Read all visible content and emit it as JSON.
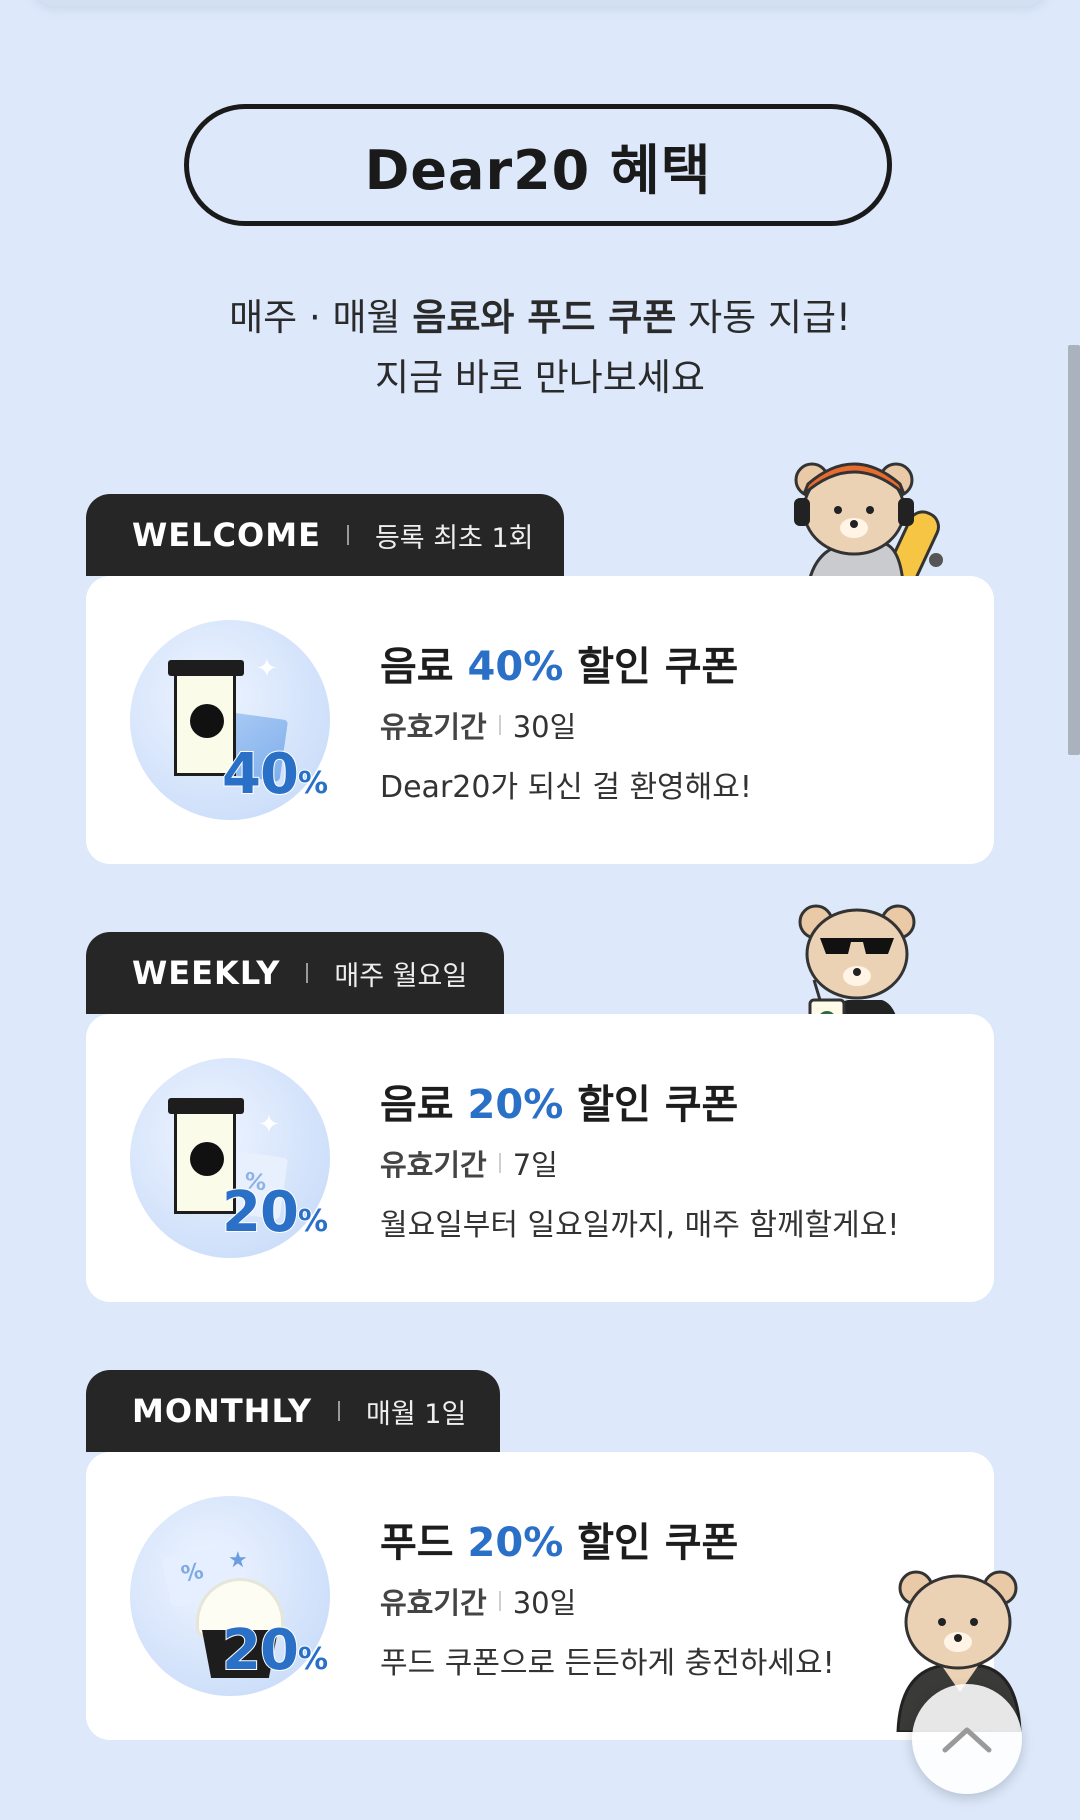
{
  "header": {
    "title": "Dear20 혜택",
    "subtitle_prefix": "매주 · 매월 ",
    "subtitle_bold": "음료와 푸드 쿠폰",
    "subtitle_suffix": " 자동 지급!",
    "subtitle_line2": "지금 바로 만나보세요"
  },
  "cards": [
    {
      "tab_title": "WELCOME",
      "tab_sub": "등록 최초 1회",
      "badge_value": "40",
      "badge_unit": "%",
      "title_prefix": "음료 ",
      "title_highlight": "40%",
      "title_suffix": " 할인 쿠폰",
      "period_label": "유효기간",
      "period_value": "30일",
      "description": "Dear20가 되신 걸 환영해요!"
    },
    {
      "tab_title": "WEEKLY",
      "tab_sub": "매주 월요일",
      "badge_value": "20",
      "badge_unit": "%",
      "ticket_symbol": "%",
      "title_prefix": "음료 ",
      "title_highlight": "20%",
      "title_suffix": " 할인 쿠폰",
      "period_label": "유효기간",
      "period_value": "7일",
      "description": "월요일부터 일요일까지, 매주 함께할게요!"
    },
    {
      "tab_title": "MONTHLY",
      "tab_sub": "매월 1일",
      "badge_value": "20",
      "badge_unit": "%",
      "ticket_symbol": "%",
      "title_prefix": "푸드 ",
      "title_highlight": "20%",
      "title_suffix": " 할인 쿠폰",
      "period_label": "유효기간",
      "period_value": "30일",
      "description": "푸드 쿠폰으로 든든하게 충전하세요!"
    }
  ],
  "icons": {
    "scroll_top": "chevron-up-icon",
    "bears": [
      "bear-headphones-skateboard",
      "bear-sunglasses-drink",
      "bear-jacket"
    ]
  },
  "colors": {
    "background": "#dde9fb",
    "accent_blue": "#2a70c7",
    "tab_dark": "#262626"
  }
}
